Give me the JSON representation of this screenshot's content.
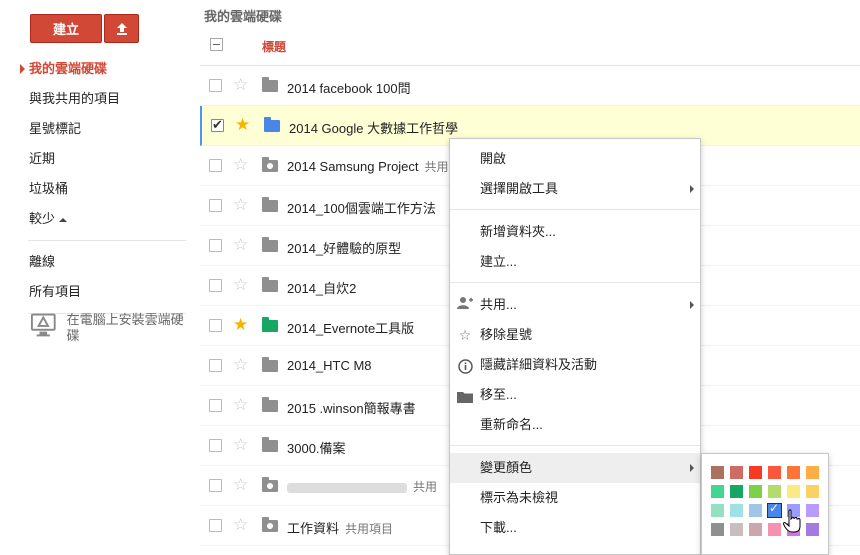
{
  "sidebar": {
    "create_label": "建立",
    "items": [
      {
        "label": "我的雲端硬碟",
        "active": true
      },
      {
        "label": "與我共用的項目"
      },
      {
        "label": "星號標記"
      },
      {
        "label": "近期"
      },
      {
        "label": "垃圾桶"
      },
      {
        "label": "較少"
      }
    ],
    "items2": [
      {
        "label": "離線"
      },
      {
        "label": "所有項目"
      }
    ],
    "install_label": "在電腦上安裝雲端硬碟"
  },
  "main": {
    "breadcrumb": "我的雲端硬碟",
    "column_title": "標題",
    "rows": [
      {
        "name": "2014 facebook 100問",
        "starred": false,
        "checked": false,
        "folder_color": "#8f8f8f",
        "shared": false
      },
      {
        "name": "2014 Google 大數據工作哲學",
        "starred": true,
        "checked": true,
        "folder_color": "#4986e7",
        "shared": false
      },
      {
        "name": "2014 Samsung Project",
        "tag": "共用",
        "starred": false,
        "checked": false,
        "folder_color": "#8f8f8f",
        "shared": true
      },
      {
        "name": "2014_100個雲端工作方法",
        "starred": false,
        "checked": false,
        "folder_color": "#8f8f8f",
        "shared": false
      },
      {
        "name": "2014_好體驗的原型",
        "starred": false,
        "checked": false,
        "folder_color": "#8f8f8f",
        "shared": false
      },
      {
        "name": "2014_自炊2",
        "starred": false,
        "checked": false,
        "folder_color": "#8f8f8f",
        "shared": false
      },
      {
        "name": "2014_Evernote工具版",
        "starred": true,
        "checked": false,
        "folder_color": "#16a765",
        "shared": false
      },
      {
        "name": "2014_HTC M8",
        "starred": false,
        "checked": false,
        "folder_color": "#8f8f8f",
        "shared": false
      },
      {
        "name": "2015 .winson簡報專書",
        "starred": false,
        "checked": false,
        "folder_color": "#8f8f8f",
        "shared": false
      },
      {
        "name": "3000.備案",
        "starred": false,
        "checked": false,
        "folder_color": "#8f8f8f",
        "shared": false
      },
      {
        "name": "",
        "tag": "共用",
        "starred": false,
        "checked": false,
        "folder_color": "#8f8f8f",
        "shared": true,
        "blurred": true
      },
      {
        "name": "工作資料",
        "tag": "共用項目",
        "starred": false,
        "checked": false,
        "folder_color": "#8f8f8f",
        "shared": true
      }
    ]
  },
  "context_menu": {
    "items": [
      {
        "label": "開啟"
      },
      {
        "label": "選擇開啟工具",
        "submenu": true
      },
      {
        "label": "新增資料夾..."
      },
      {
        "label": "建立...",
        "submenu": false
      },
      {
        "label": "共用...",
        "submenu": true,
        "icon": "add-person-icon"
      },
      {
        "label": "移除星號",
        "icon": "star-outline-icon"
      },
      {
        "label": "隱藏詳細資料及活動",
        "icon": "info-icon"
      },
      {
        "label": "移至...",
        "icon": "folder-move-icon"
      },
      {
        "label": "重新命名..."
      },
      {
        "label": "變更顏色",
        "submenu": true,
        "highlighted": true
      },
      {
        "label": "標示為未檢視"
      },
      {
        "label": "下載..."
      }
    ]
  },
  "color_palette": {
    "colors": [
      "#ac725e",
      "#d06b64",
      "#f83a22",
      "#fa573c",
      "#ff7537",
      "#ffad46",
      "#42d692",
      "#16a765",
      "#7bd148",
      "#b3dc6c",
      "#fbe983",
      "#fad165",
      "#92e1c0",
      "#9fe1e7",
      "#9fc6e7",
      "#4986e7",
      "#9a9cff",
      "#b99aff",
      "#8f8f8f",
      "#cabdbf",
      "#cca6ac",
      "#f691b2",
      "#cd74e6",
      "#a47ae2"
    ],
    "selected_index": 15
  }
}
